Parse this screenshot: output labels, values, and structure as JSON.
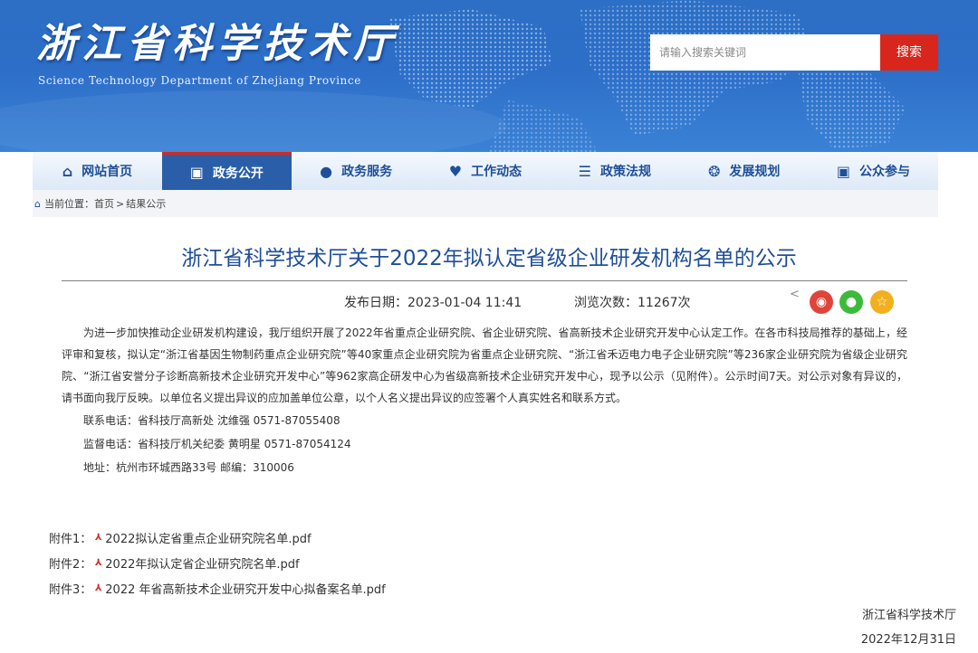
{
  "header": {
    "site_title": "浙江省科学技术厅",
    "site_subtitle": "Science Technology Department of Zhejiang Province",
    "search_placeholder": "请输入搜索关键词",
    "search_button": "搜索"
  },
  "nav": {
    "items": [
      {
        "label": "网站首页",
        "icon": "home-icon"
      },
      {
        "label": "政务公开",
        "icon": "org-icon",
        "active": true
      },
      {
        "label": "政务服务",
        "icon": "chat-icon"
      },
      {
        "label": "工作动态",
        "icon": "heart-icon"
      },
      {
        "label": "政策法规",
        "icon": "document-icon"
      },
      {
        "label": "发展规划",
        "icon": "handshake-icon"
      },
      {
        "label": "公众参与",
        "icon": "people-icon"
      }
    ]
  },
  "breadcrumb": {
    "prefix": "当前位置：",
    "items": [
      "首页",
      "结果公示"
    ],
    "separator": ">"
  },
  "article": {
    "title": "浙江省科学技术厅关于2022年拟认定省级企业研发机构名单的公示",
    "publish_label": "发布日期：",
    "publish_date": "2023-01-04 11:41",
    "views_label": "浏览次数：",
    "views": "11267次",
    "body": "为进一步加快推动企业研发机构建设，我厅组织开展了2022年省重点企业研究院、省企业研究院、省高新技术企业研究开发中心认定工作。在各市科技局推荐的基础上，经评审和复核，拟认定“浙江省基因生物制药重点企业研究院”等40家重点企业研究院为省重点企业研究院、“浙江省禾迈电力电子企业研究院”等236家企业研究院为省级企业研究院、“浙江省安誉分子诊断高新技术企业研究开发中心”等962家高企研发中心为省级高新技术企业研究开发中心，现予以公示（见附件）。公示时间7天。对公示对象有异议的，请书面向我厅反映。以单位名义提出异议的应加盖单位公章，以个人名义提出异议的应签署个人真实姓名和联系方式。",
    "contacts": [
      "联系电话：省科技厅高新处    沈维强 0571-87055408",
      "监督电话：省科技厅机关纪委  黄明星 0571-87054124",
      "地址：杭州市环城西路33号   邮编：310006"
    ],
    "attachments": [
      {
        "label": "附件1：",
        "file": "2022拟认定省重点企业研究院名单.pdf"
      },
      {
        "label": "附件2：",
        "file": "2022年拟认定省企业研究院名单.pdf"
      },
      {
        "label": "附件3：",
        "file": "2022 年省高新技术企业研究开发中心拟备案名单.pdf"
      }
    ],
    "signature_org": "浙江省科学技术厅",
    "signature_date": "2022年12月31日"
  },
  "share": {
    "icons": [
      "share-icon",
      "weibo-icon",
      "wechat-icon",
      "favorite-icon"
    ],
    "colors": {
      "weibo": "#e0433a",
      "wechat": "#3dba3a",
      "favorite": "#f2b01e"
    }
  },
  "colors": {
    "brand_blue": "#1f4f99",
    "banner_blue": "#2d6ec8",
    "accent_red": "#d9261c"
  }
}
